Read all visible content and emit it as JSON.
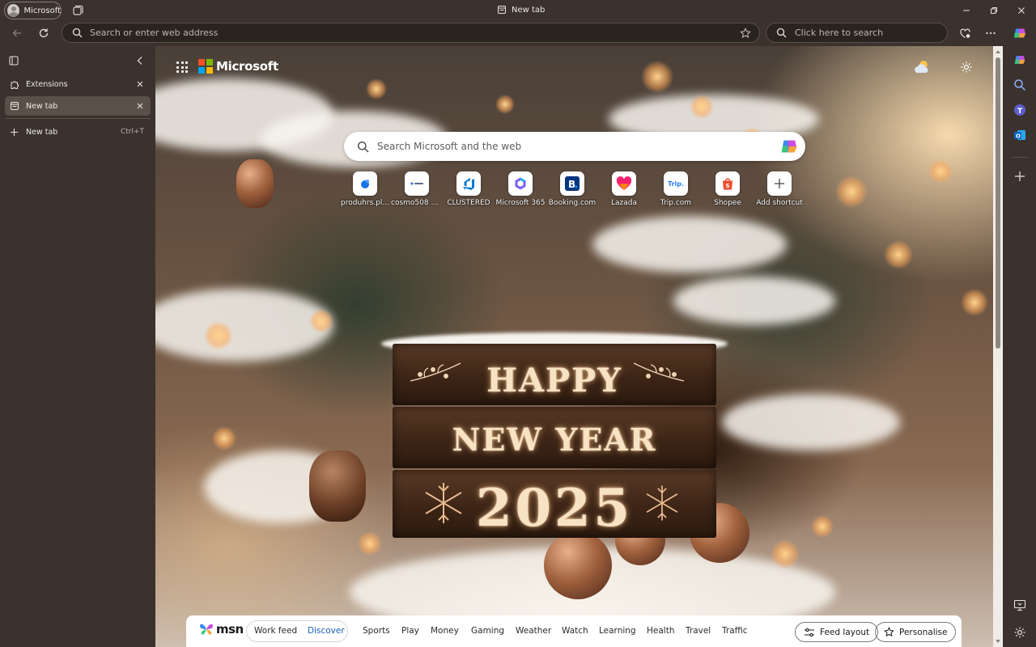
{
  "window": {
    "profile_label": "Microsoft",
    "title": "New tab"
  },
  "navbar": {
    "address_placeholder": "Search or enter web address",
    "search_placeholder": "Click here to search"
  },
  "tabs_panel": {
    "tabs": [
      {
        "label": "Extensions",
        "active": false
      },
      {
        "label": "New tab",
        "active": true
      }
    ],
    "new_tab_label": "New tab",
    "new_tab_shortcut": "Ctrl+T"
  },
  "newtab_page": {
    "brand": "Microsoft",
    "search_placeholder": "Search Microsoft and the web",
    "shortcuts": [
      {
        "label": "produhrs.pl...",
        "icon": "blue-drop-icon",
        "color": "#1a73e8"
      },
      {
        "label": "cosmo508 A...",
        "icon": "cosmo-logo-icon",
        "color": "#5a6c8a"
      },
      {
        "label": "CLUSTERED",
        "icon": "azure-devops-icon",
        "color": "#0078d4"
      },
      {
        "label": "Microsoft 365",
        "icon": "m365-icon",
        "color": "#7b61ff"
      },
      {
        "label": "Booking.com",
        "icon": "booking-icon",
        "color": "#003580"
      },
      {
        "label": "Lazada",
        "icon": "lazada-heart-icon",
        "color": "#f5226d"
      },
      {
        "label": "Trip.com",
        "icon": "trip-icon",
        "color": "#287dfa"
      },
      {
        "label": "Shopee",
        "icon": "shopee-bag-icon",
        "color": "#ee4d2d"
      },
      {
        "label": "Add shortcut",
        "icon": "plus-icon",
        "color": "#444444"
      }
    ],
    "background_text": {
      "line1": "HAPPY",
      "line2": "NEW YEAR",
      "line3": "2025"
    }
  },
  "msn_bar": {
    "logo": "msn",
    "feed_tabs": [
      {
        "label": "Work feed",
        "active": false
      },
      {
        "label": "Discover",
        "active": true
      }
    ],
    "nav_links": [
      "Sports",
      "Play",
      "Money",
      "Gaming",
      "Weather",
      "Watch",
      "Learning",
      "Health",
      "Travel",
      "Traffic"
    ],
    "feed_layout_label": "Feed layout",
    "personalise_label": "Personalise"
  }
}
